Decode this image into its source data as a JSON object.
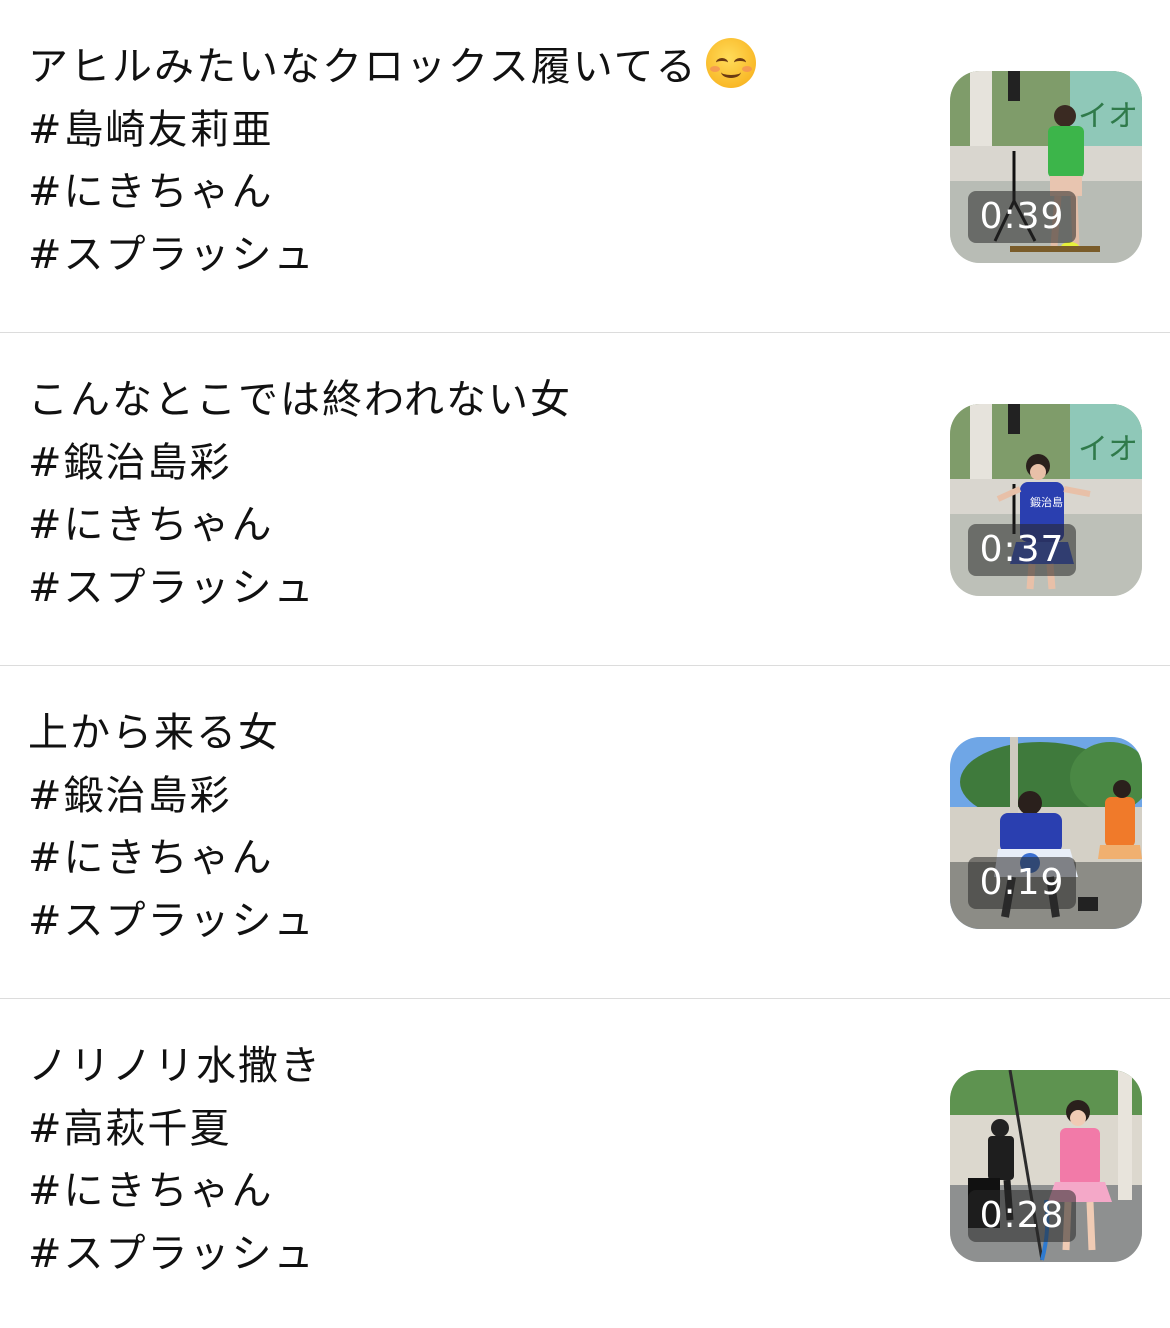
{
  "posts": [
    {
      "title": "アヒルみたいなクロックス履いてる",
      "title_emoji": "smiling-face-icon",
      "tags": [
        "#島崎友莉亜",
        "#にきちゃん",
        "#スプラッシュ"
      ],
      "duration": "0:39",
      "thumbnail_subject": "green-vest-performer"
    },
    {
      "title": "こんなとこでは終われない女",
      "tags": [
        "#鍛治島彩",
        "#にきちゃん",
        "#スプラッシュ"
      ],
      "duration": "0:37",
      "thumbnail_subject": "blue-vest-performer"
    },
    {
      "title": "上から来る女",
      "tags": [
        "#鍛治島彩",
        "#にきちゃん",
        "#スプラッシュ"
      ],
      "duration": "0:19",
      "thumbnail_subject": "outdoor-stage-performers"
    },
    {
      "title": "ノリノリ水撒き",
      "tags": [
        "#高萩千夏",
        "#にきちゃん",
        "#スプラッシュ"
      ],
      "duration": "0:28",
      "thumbnail_subject": "pink-vest-performer-with-hose"
    }
  ],
  "colors": {
    "text": "#111111",
    "divider": "#dcdcdc",
    "background": "#ffffff"
  }
}
